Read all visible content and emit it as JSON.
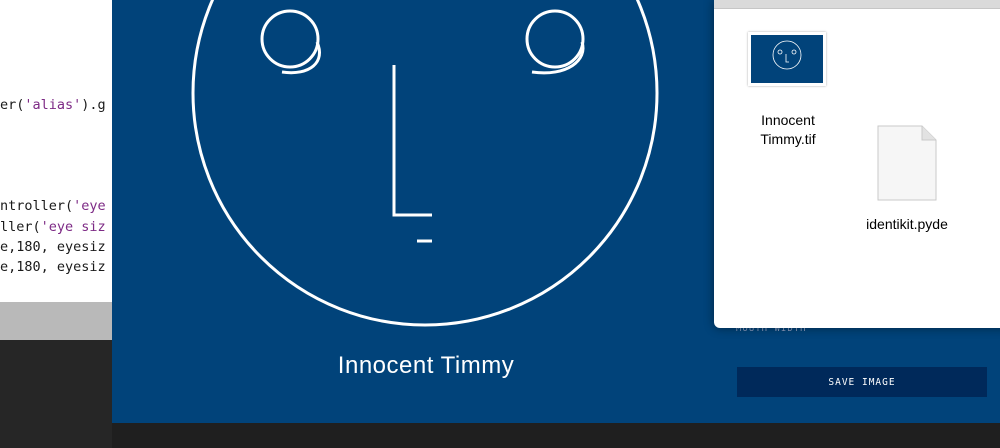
{
  "editor": {
    "lines": [
      {
        "pre": "er(",
        "str": "'alias'",
        "post": ").g"
      },
      {
        "pre": "ntroller(",
        "str": "'eye",
        "post": ""
      },
      {
        "pre": "ller(",
        "str": "'eye siz",
        "post": ""
      },
      {
        "pre": "e,180, eyesiz",
        "str": "",
        "post": ""
      },
      {
        "pre": "e,180, eyesiz",
        "str": "",
        "post": ""
      }
    ]
  },
  "sketch": {
    "title": "Innocent Timmy",
    "control_label": "MOUTH WIDTH",
    "save_label": "SAVE IMAGE",
    "colors": {
      "background": "#01437a",
      "button": "#00295a",
      "stroke": "#ffffff"
    }
  },
  "finder": {
    "files": [
      {
        "name_line1": "Innocent",
        "name_line2": "Timmy.tif",
        "icon": "image-thumbnail-icon"
      },
      {
        "name_line1": "identikit.pyde",
        "name_line2": "",
        "icon": "document-icon"
      }
    ]
  }
}
